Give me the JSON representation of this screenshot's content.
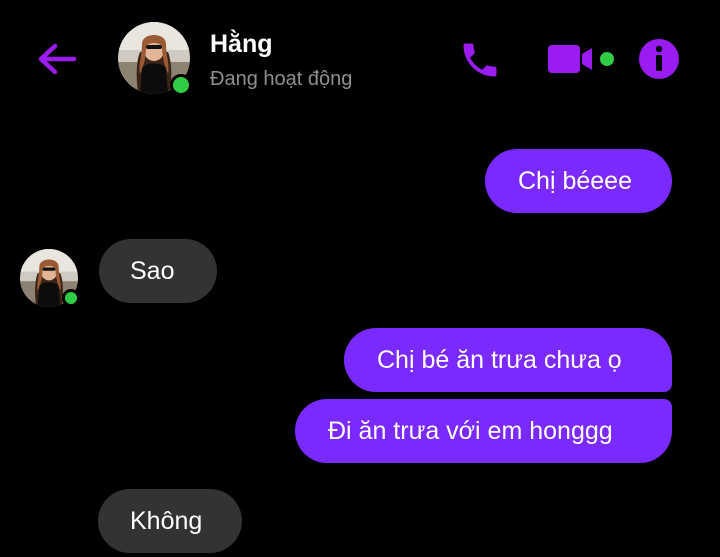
{
  "header": {
    "contact_name": "Hằng",
    "status": "Đang hoạt động"
  },
  "icons": {
    "back": "arrow-left-icon",
    "call": "phone-icon",
    "video": "video-camera-icon",
    "info": "info-icon"
  },
  "colors": {
    "accent": "#9b1cf0",
    "outgoing_bubble": "#7a29ff",
    "incoming_bubble": "#333335",
    "online": "#31cc46",
    "background": "#000000"
  },
  "messages": [
    {
      "direction": "outgoing",
      "text": "Chị béeee"
    },
    {
      "direction": "incoming",
      "text": "Sao"
    },
    {
      "direction": "outgoing",
      "text": "Chị bé ăn trưa chưa ọ"
    },
    {
      "direction": "outgoing",
      "text": "Đi ăn trưa với em honggg"
    },
    {
      "direction": "incoming",
      "text": "Không"
    }
  ]
}
